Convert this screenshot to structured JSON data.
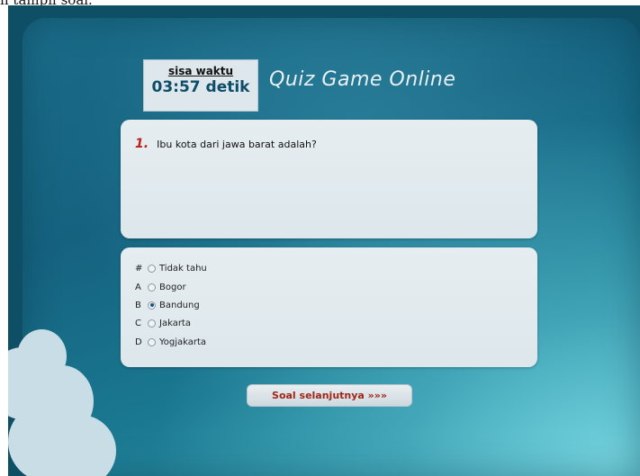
{
  "caption": "h tampil soal.",
  "timer": {
    "label": "sisa waktu",
    "value": "03:57 detik"
  },
  "app_title": "Quiz Game Online",
  "question": {
    "number": "1.",
    "text": "Ibu kota dari jawa barat adalah?"
  },
  "options": [
    {
      "key": "#",
      "label": "Tidak tahu",
      "selected": false
    },
    {
      "key": "A",
      "label": "Bogor",
      "selected": false
    },
    {
      "key": "B",
      "label": "Bandung",
      "selected": true
    },
    {
      "key": "C",
      "label": "Jakarta",
      "selected": false
    },
    {
      "key": "D",
      "label": "Yogjakarta",
      "selected": false
    }
  ],
  "next_button": {
    "label": "Soal selanjutnya »»»"
  },
  "colors": {
    "panel_dark": "#15627f",
    "panel_light": "#78d7e1",
    "card": "#dde7ec",
    "question_number": "#c0201a",
    "button_text": "#a2261a",
    "cloud": "#c8dde6"
  }
}
